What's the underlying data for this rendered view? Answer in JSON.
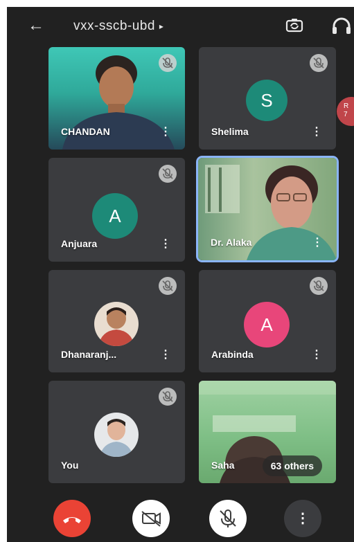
{
  "meeting": {
    "code": "vxx-sscb-ubd",
    "caret": "▸"
  },
  "icons": {
    "back": "arrow-left-icon",
    "switch_camera": "camera-switch-icon",
    "audio_output": "headphones-icon",
    "mic_off": "mic-off-icon",
    "more": "more-vertical-icon",
    "end_call": "phone-hangup-icon",
    "camera_off": "video-off-icon"
  },
  "colors": {
    "background": "#212121",
    "tile": "#3b3c3f",
    "avatar_teal": "#1d8a78",
    "avatar_pink": "#e8467a",
    "end_call": "#ea4335",
    "selected_border": "#8ab4f8"
  },
  "participants": [
    {
      "name": "CHANDAN",
      "kind": "video",
      "muted": true
    },
    {
      "name": "Shelima",
      "kind": "initial",
      "initial": "S",
      "muted": true
    },
    {
      "name": "Anjuara",
      "kind": "initial",
      "initial": "A",
      "muted": true
    },
    {
      "name": "Dr. Alaka",
      "kind": "video",
      "muted": false,
      "selected": true
    },
    {
      "name": "Dhanaranj...",
      "kind": "photo",
      "muted": true
    },
    {
      "name": "Arabinda",
      "kind": "initial",
      "initial": "A",
      "muted": true
    },
    {
      "name": "You",
      "kind": "photo",
      "muted": true
    },
    {
      "name": "Saha",
      "kind": "video",
      "others_label": "63 others"
    }
  ],
  "side_participant": {
    "label_line1": "R",
    "label_line2": "7"
  },
  "controls": {
    "more_glyph": "⋮",
    "kebab_glyph": "⋮"
  }
}
